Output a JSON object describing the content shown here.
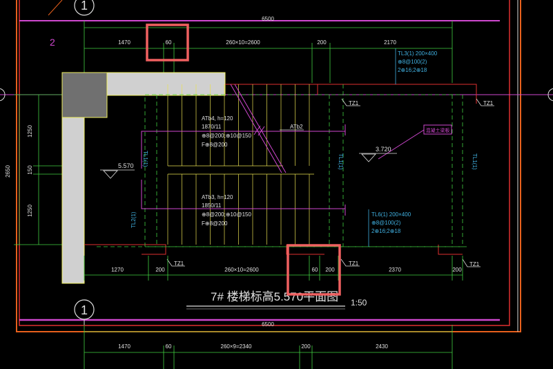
{
  "drawing": {
    "title": "7# 楼梯标高5.570平面图",
    "scale": "1:50",
    "axis_label": "1",
    "axis_label_top": "1",
    "grid_label_2": "2"
  },
  "dims": {
    "total_top": "6500",
    "total_bottom": "6500",
    "top_row": [
      "1470",
      "60",
      "260×10=2600",
      "200",
      "2170"
    ],
    "bottom_row": [
      "1270",
      "200",
      "260×10=2600",
      "60",
      "200",
      "2370",
      "200"
    ],
    "lower_row": [
      "1470",
      "60",
      "260×9=2340",
      "200",
      "2430"
    ],
    "left_total": "2650",
    "left_parts": [
      "1250",
      "150",
      "1250"
    ]
  },
  "stairs": {
    "upper_label": [
      "ATb4, h=120",
      "1870/11",
      "⊕8@200;⊕10@150",
      "F⊕8@200"
    ],
    "lower_label": [
      "ATb3, h=120",
      "1850/11",
      "⊕8@200;⊕10@150",
      "F⊕8@200"
    ],
    "atb2": "ATb2"
  },
  "levels": {
    "left": "5.570",
    "right": "3.720"
  },
  "beams": {
    "tl3": [
      "TL3(1) 200×400",
      "⊕8@100(2)",
      "2⊕16;2⊕18"
    ],
    "tl6": [
      "TL6(1) 200×400",
      "⊕8@100(2)",
      "2⊕16;2⊕18"
    ],
    "tl1_left": "TL1(1)",
    "tl1_right": "TL1(1)",
    "tl1_far": "TL1(1)",
    "tl2": "TL2(1)"
  },
  "columns": {
    "tz_labels": [
      "TZ1",
      "TZ1",
      "TZ1",
      "TZ1",
      "TZ1",
      "TZ1"
    ]
  },
  "note_tag": "混凝土梁板"
}
